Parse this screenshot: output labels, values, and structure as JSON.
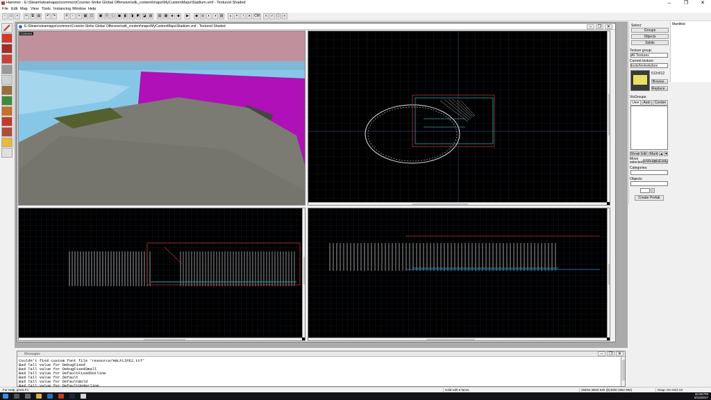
{
  "app": {
    "title": "Hammer - E:\\Steam\\steamapps\\common\\Counter-Strike Global Offensive\\sdk_content\\maps\\MyCustomMaps\\Stadium.vmf - Textured Shaded",
    "window_controls": {
      "minimize": "–",
      "maximize": "❐",
      "close": "✕"
    }
  },
  "menu": [
    "File",
    "Edit",
    "Map",
    "View",
    "Tools",
    "Instancing",
    "Window",
    "Help"
  ],
  "document": {
    "title": "E:\\Steam\\steamapps\\common\\Counter-Strike Global Offensive\\sdk_content\\maps\\MyCustomMaps\\Stadium.vmf - Textured Shaded",
    "camera_label": "Camera"
  },
  "toolbar": {
    "cm_label": "CM"
  },
  "right_panel": {
    "select_label": "Select:",
    "groups": "Groups",
    "objects": "Objects",
    "solids": "Solids",
    "texture_group_label": "Texture group:",
    "texture_group_value": "All Textures",
    "current_texture_label": "Current texture:",
    "current_texture_value": "tools/toolsskybox",
    "texture_size": "512x512",
    "browse": "Browse...",
    "replace": "Replace...",
    "visgroups_label": "VisGroups:",
    "tabs": [
      "User",
      "Auto",
      "Cordon"
    ],
    "show": "Show",
    "edit": "Edit",
    "mark": "Mark",
    "move_selected_label": "Move selected:",
    "to_world": "toWorld",
    "to_entity": "toEntity",
    "categories_label": "Categories:",
    "objects_label": "Objects:",
    "create_prefab": "Create Prefab"
  },
  "manifest": {
    "title": "Manifest"
  },
  "messages": {
    "title": "Messages",
    "lines": [
      "Couldn't find custom font file 'resource/HALFLIFE2.ttf'",
      "Bad Tall value for DebugFixed",
      "Bad Tall value for DebugFixedSmall",
      "Bad Tall value for DefaultFixedOutline",
      "Bad Tall value for Default",
      "Bad Tall value for DefaultBold",
      "Bad Tall value for DefaultUnderline"
    ]
  },
  "status": {
    "help": "For Help, press F1",
    "selection": "solid with 6 faces",
    "size": "2560w 3904l 64h @(4000 1952 992)",
    "grid": "Snap: On Grid: 64"
  },
  "clock": {
    "time": "10:48 PM",
    "date": "5/12/2017"
  }
}
